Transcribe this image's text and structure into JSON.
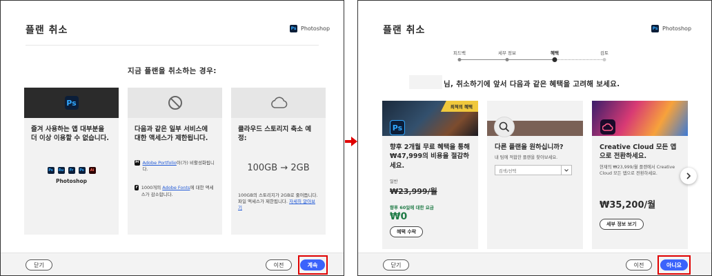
{
  "left": {
    "title": "플랜 취소",
    "app_name": "Photoshop",
    "heading": "지금 플랜을 취소하는 경우:",
    "cards": [
      {
        "icon": "ps-logo-icon",
        "text": "즐겨 사용하는 앱 대부분을 더 이상 이용할 수 없습니다.",
        "apps_label": "Photoshop",
        "apps": [
          "Ps",
          "Ru",
          "Fr",
          "Ps",
          "Ai"
        ]
      },
      {
        "icon": "prohibited-icon",
        "text": "다음과 같은 일부 서비스에 대한 액세스가 제한됩니다.",
        "item1_pre": "",
        "item1_link": "Adobe Portfolio",
        "item1_post": "이(가) 비활성화됩니다.",
        "item2_pre": "1000개의 ",
        "item2_link": "Adobe Fonts",
        "item2_post": "에 대한 액세스가 감소합니다."
      },
      {
        "icon": "cloud-icon",
        "text": "클라우드 스토리지 축소 예정:",
        "from": "100GB",
        "arrow": "→",
        "to": "2GB",
        "note": "100GB의 스토리지가 2GB로 줄어듭니다. 파일 액세스가 제한됩니다.",
        "note_link": "자세히 알아보기"
      }
    ],
    "close_label": "닫기",
    "prev_label": "이전",
    "next_label": "계속"
  },
  "right": {
    "title": "플랜 취소",
    "app_name": "Photoshop",
    "steps": [
      "피드백",
      "세부 정보",
      "혜택",
      "검토"
    ],
    "heading": "님, 취소하기에 앞서 다음과 같은 혜택을 고려해 보세요.",
    "cards": [
      {
        "badge": "최적의 혜택",
        "title": "향후 2개월 무료 혜택을 통해 ₩47,999의 비용을 절감하세요.",
        "regular_label": "일반",
        "regular_price": "₩23,999/월",
        "offer_label": "향후 60일에 대한 요금",
        "offer_price": "₩0",
        "button": "혜택 수락"
      },
      {
        "title": "다른 플랜을 원하십니까?",
        "desc": "내 팀에 적합한 플랜을 찾아보세요.",
        "select_placeholder": "검색/선택"
      },
      {
        "title": "Creative Cloud 모든 앱으로 전환하세요.",
        "desc": "현재의 ₩23,999/월 플랜에서 Creative Cloud 모든 앱으로 전환하세요.",
        "price": "₩35,200/월",
        "button": "세부 정보 보기"
      }
    ],
    "close_label": "닫기",
    "prev_label": "이전",
    "no_label": "아니요"
  },
  "colors": {
    "primary": "#3b63fb",
    "highlight": "#e00000",
    "offer_green": "#1e7a45",
    "badge_gold": "#f0c83c"
  }
}
